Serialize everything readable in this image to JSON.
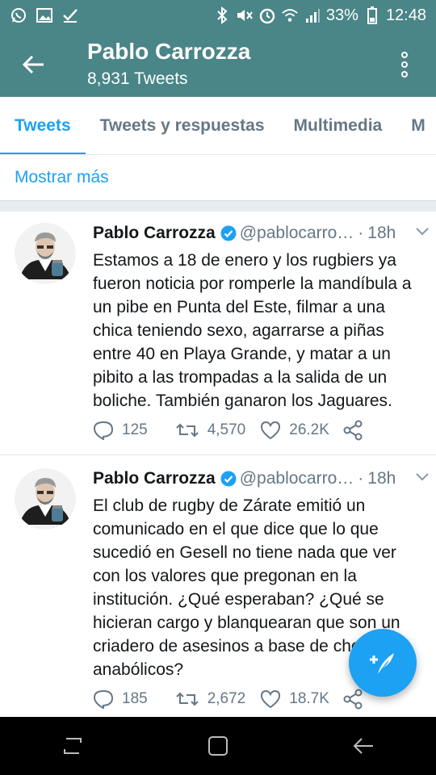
{
  "status_bar": {
    "battery": "33%",
    "time": "12:48",
    "left_icons": [
      "whatsapp-icon",
      "gallery-icon",
      "check-icon"
    ],
    "right_icons": [
      "bluetooth-icon",
      "mute-icon",
      "alarm-icon",
      "wifi-icon",
      "signal-icon",
      "battery-icon"
    ]
  },
  "app_bar": {
    "title": "Pablo Carrozza",
    "subtitle": "8,931 Tweets"
  },
  "tabs": [
    {
      "label": "Tweets",
      "active": true
    },
    {
      "label": "Tweets y respuestas",
      "active": false
    },
    {
      "label": "Multimedia",
      "active": false
    },
    {
      "label": "M",
      "active": false
    }
  ],
  "show_more": "Mostrar más",
  "tweets": [
    {
      "name": "Pablo Carrozza",
      "handle": "@pablocarro…",
      "separator": "·",
      "time": "18h",
      "text": "Estamos a 18 de enero y los rugbiers ya fueron noticia por romperle la mandíbula a un pibe en Punta del Este, filmar a una chica teniendo sexo, agarrarse a piñas entre 40 en Playa Grande, y matar a un pibito a las trompadas a la salida de un boliche. También ganaron los Jaguares.",
      "replies": "125",
      "retweets": "4,570",
      "likes": "26.2K"
    },
    {
      "name": "Pablo Carrozza",
      "handle": "@pablocarro…",
      "separator": "·",
      "time": "18h",
      "text": "El club de rugby de Zárate emitió un comunicado en el que dice que lo que sucedió en Gesell no tiene nada que ver con los valores que pregonan en la institución. ¿Qué esperaban? ¿Qué se hicieran cargo y blanquearan que son un criadero de asesinos a base de chetos y anabólicos?",
      "replies": "185",
      "retweets": "2,672",
      "likes": "18.7K"
    }
  ],
  "colors": {
    "header": "#4a8588",
    "accent": "#1da1f2",
    "muted": "#657786"
  }
}
